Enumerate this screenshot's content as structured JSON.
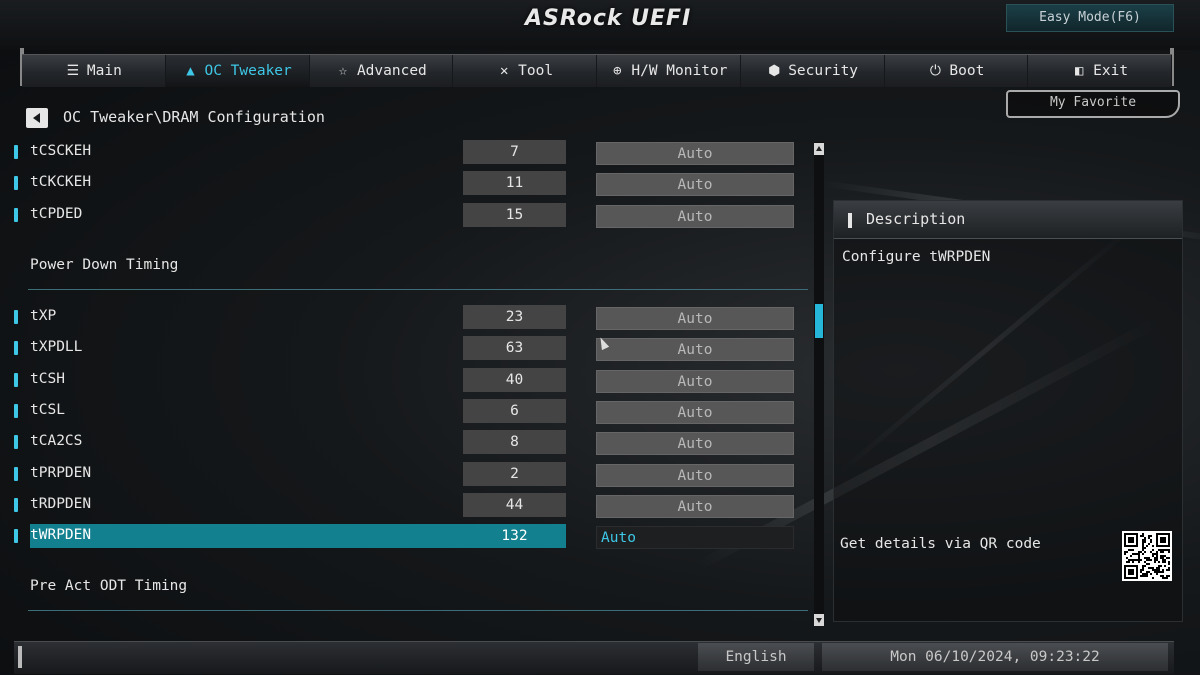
{
  "brand": {
    "logo": "ASRock UEFI",
    "easy_mode": "Easy Mode(F6)"
  },
  "nav": [
    {
      "label": "Main",
      "icon": "list-icon",
      "active": false
    },
    {
      "label": "OC Tweaker",
      "icon": "rocket-icon",
      "active": true
    },
    {
      "label": "Advanced",
      "icon": "star-icon",
      "active": false
    },
    {
      "label": "Tool",
      "icon": "tools-icon",
      "active": false
    },
    {
      "label": "H/W Monitor",
      "icon": "monitor-icon",
      "active": false
    },
    {
      "label": "Security",
      "icon": "shield-icon",
      "active": false
    },
    {
      "label": "Boot",
      "icon": "power-icon",
      "active": false
    },
    {
      "label": "Exit",
      "icon": "exit-icon",
      "active": false
    }
  ],
  "breadcrumb": "OC Tweaker\\DRAM Configuration",
  "my_favorite": "My Favorite",
  "rows_top": [
    {
      "name": "tCSCKEH",
      "value": "7",
      "setting": "Auto"
    },
    {
      "name": "tCKCKEH",
      "value": "11",
      "setting": "Auto"
    },
    {
      "name": "tCPDED",
      "value": "15",
      "setting": "Auto"
    }
  ],
  "section_power_down": "Power Down Timing",
  "rows_power_down": [
    {
      "name": "tXP",
      "value": "23",
      "setting": "Auto"
    },
    {
      "name": "tXPDLL",
      "value": "63",
      "setting": "Auto"
    },
    {
      "name": "tCSH",
      "value": "40",
      "setting": "Auto"
    },
    {
      "name": "tCSL",
      "value": "6",
      "setting": "Auto"
    },
    {
      "name": "tCA2CS",
      "value": "8",
      "setting": "Auto"
    },
    {
      "name": "tPRPDEN",
      "value": "2",
      "setting": "Auto"
    },
    {
      "name": "tRDPDEN",
      "value": "44",
      "setting": "Auto"
    },
    {
      "name": "tWRPDEN",
      "value": "132",
      "setting": "Auto",
      "selected": true
    }
  ],
  "section_pre_act": "Pre Act ODT Timing",
  "scrollbar": {
    "position_fraction": 0.35
  },
  "description": {
    "title": "Description",
    "text": "Configure tWRPDEN",
    "qr_text": "Get details via QR code"
  },
  "status": {
    "language": "English",
    "datetime": "Mon 06/10/2024, 09:23:22"
  },
  "colors": {
    "accent": "#3ec7e6",
    "selected_row": "#12808f",
    "scroll_thumb": "#25b6d8"
  }
}
